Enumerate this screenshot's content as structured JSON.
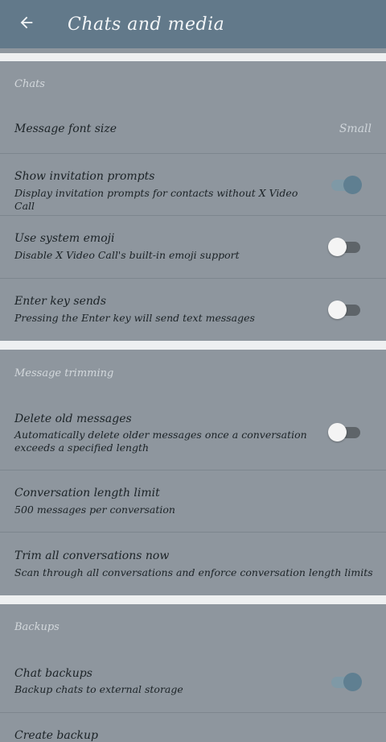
{
  "appbar": {
    "title": "Chats and media",
    "back_icon": "arrow-left-icon"
  },
  "sections": [
    {
      "header": "Chats"
    },
    {
      "header": "Message trimming"
    },
    {
      "header": "Backups"
    }
  ],
  "chats": {
    "font_size": {
      "title": "Message font size",
      "value": "Small"
    },
    "invitation": {
      "title": "Show invitation prompts",
      "subtitle": "Display invitation prompts for contacts without X Video Call",
      "enabled": true
    },
    "emoji": {
      "title": "Use system emoji",
      "subtitle": "Disable X Video Call's built-in emoji support",
      "enabled": false
    },
    "enter_key": {
      "title": "Enter key sends",
      "subtitle": "Pressing the Enter key will send text messages",
      "enabled": false
    }
  },
  "trimming": {
    "delete_old": {
      "title": "Delete old messages",
      "subtitle": "Automatically delete older messages once a conversation exceeds a specified length",
      "enabled": false
    },
    "length_limit": {
      "title": "Conversation length limit",
      "subtitle": "500 messages per conversation"
    },
    "trim_now": {
      "title": "Trim all conversations now",
      "subtitle": "Scan through all conversations and enforce conversation length limits"
    }
  },
  "backups": {
    "chat_backups": {
      "title": "Chat backups",
      "subtitle": "Backup chats to external storage",
      "enabled": true
    },
    "create_backup": {
      "title": "Create backup"
    }
  },
  "colors": {
    "appbar": "#62798a",
    "background": "#8e969e",
    "accent": "#5f7f91"
  }
}
